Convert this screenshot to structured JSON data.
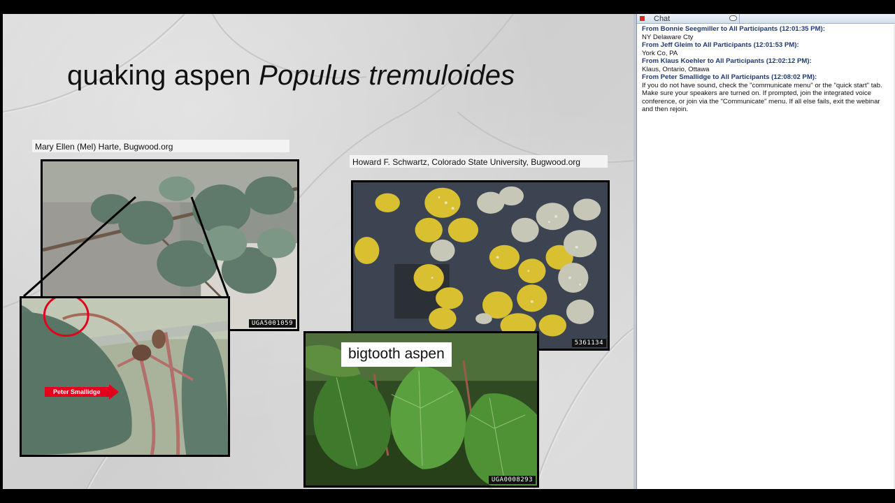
{
  "slide": {
    "title_common": "quaking aspen",
    "title_scientific": "Populus tremuloides",
    "credit_left": "Mary Ellen (Mel)  Harte, Bugwood.org",
    "credit_right": "Howard  F. Schwartz, Colorado  State University,  Bugwood.org",
    "photo_ids": {
      "quaking_branch": "UGA5001059",
      "fallen_leaves": "5361134",
      "bigtooth": "UGA0008293"
    },
    "arrow_label": "Peter Smallidge",
    "bigtooth_label": "bigtooth aspen"
  },
  "chat": {
    "title": "Chat",
    "messages": [
      {
        "from": "From Bonnie Seegmiller to All Participants (12:01:35 PM):",
        "text": "NY Delaware Cty"
      },
      {
        "from": "From Jeff Gleim to All Participants (12:01:53 PM):",
        "text": "York Co, PA"
      },
      {
        "from": "From Klaus Koehler to All Participants (12:02:12 PM):",
        "text": "Klaus, Ontario, Ottawa"
      },
      {
        "from": "From Peter Smallidge to All Participants (12:08:02 PM):",
        "text": "If you do not have sound, check the \"communicate menu\" or the \"quick start\" tab.  Make sure your speakers are turned on.   If prompted, join the integrated voice conference, or join via the \"Communicate\" menu.  If all else fails, exit the webinar and then rejoin."
      }
    ]
  }
}
